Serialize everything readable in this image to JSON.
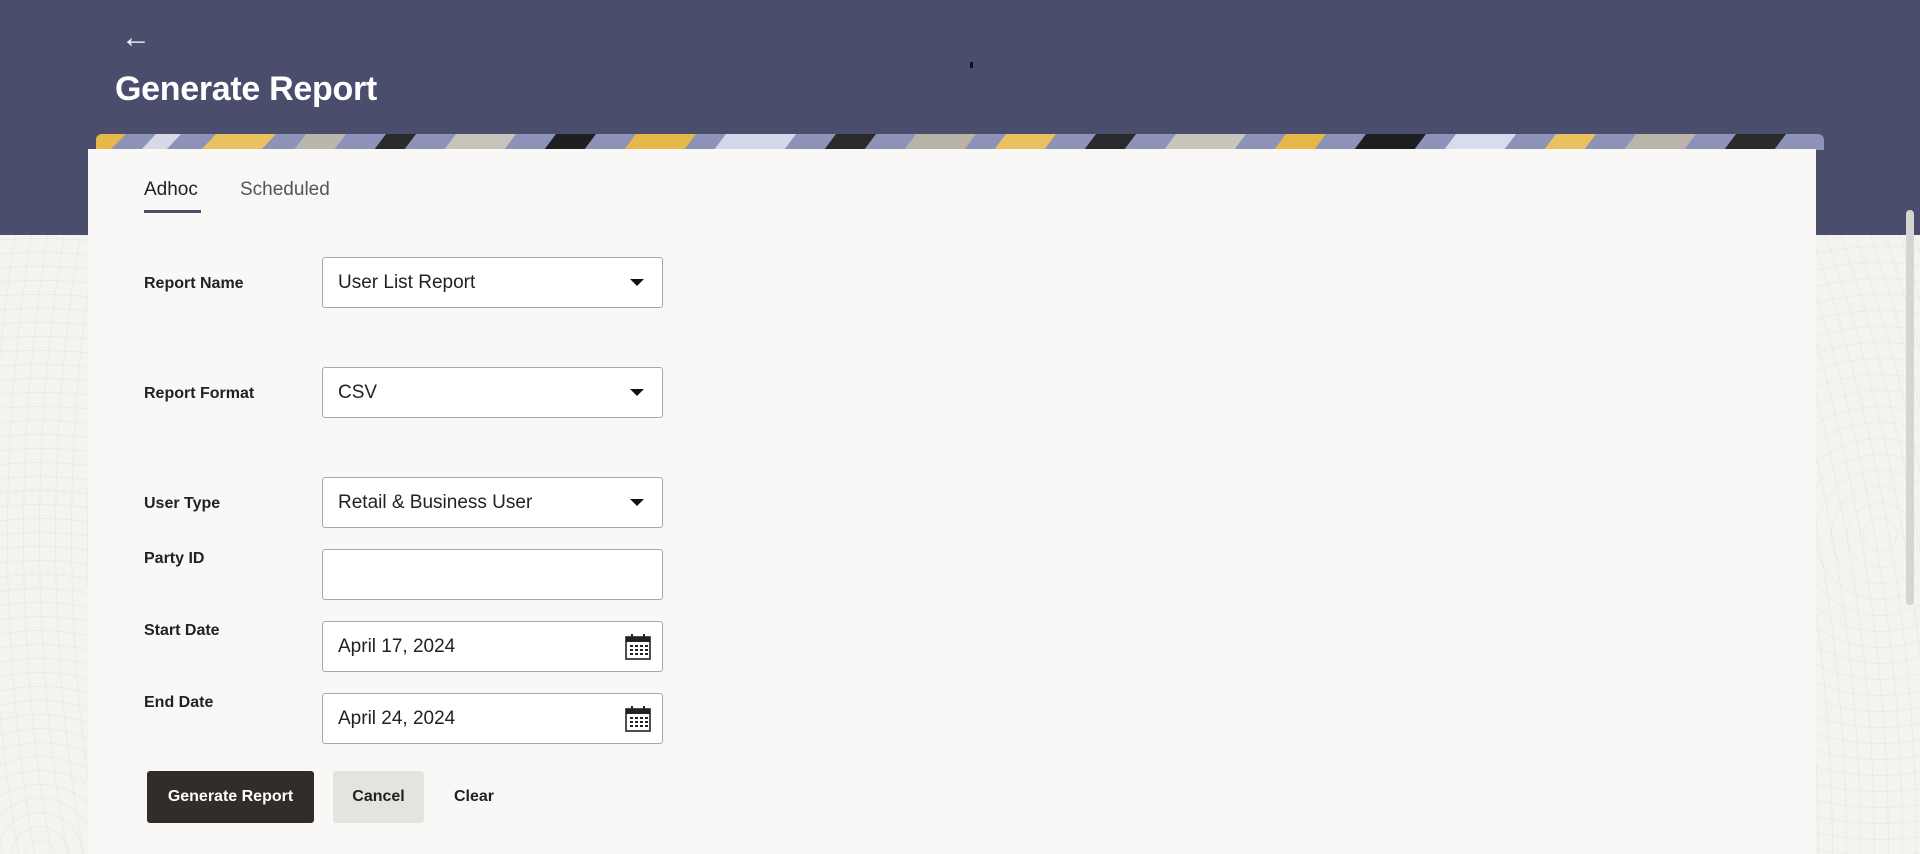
{
  "header": {
    "back_icon": "arrow-left-icon",
    "title": "Generate Report"
  },
  "tabs": [
    {
      "label": "Adhoc",
      "active": true
    },
    {
      "label": "Scheduled",
      "active": false
    }
  ],
  "form": {
    "report_name": {
      "label": "Report Name",
      "value": "User List Report"
    },
    "report_format": {
      "label": "Report Format",
      "value": "CSV"
    },
    "user_type": {
      "label": "User Type",
      "value": "Retail & Business User"
    },
    "party_id": {
      "label": "Party ID",
      "value": ""
    },
    "start_date": {
      "label": "Start Date",
      "value": "April 17, 2024",
      "icon": "calendar-icon"
    },
    "end_date": {
      "label": "End Date",
      "value": "April 24, 2024",
      "icon": "calendar-icon"
    }
  },
  "actions": {
    "generate": "Generate Report",
    "cancel": "Cancel",
    "clear": "Clear"
  },
  "colors": {
    "header_bg": "#4a4d6b",
    "primary_button": "#312d2a",
    "card_bg": "#f9f8f6"
  }
}
